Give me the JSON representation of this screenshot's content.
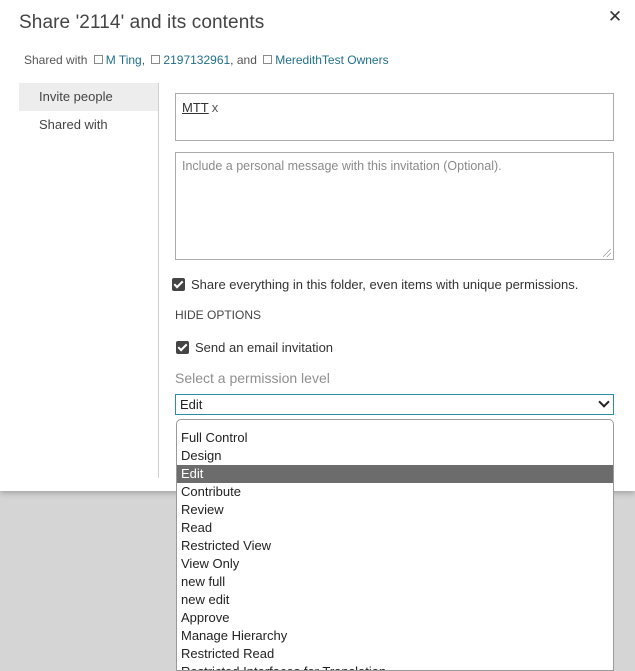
{
  "dialog": {
    "title": "Share '2114' and its contents",
    "close_label": "✕"
  },
  "shared_with": {
    "prefix": "Shared with",
    "users": [
      {
        "name": "M Ting",
        "sep": ","
      },
      {
        "name": "2197132961",
        "sep": ", and"
      },
      {
        "name": "MeredithTest Owners",
        "sep": ""
      }
    ]
  },
  "sidebar": {
    "items": [
      {
        "label": "Invite people",
        "active": true
      },
      {
        "label": "Shared with",
        "active": false
      }
    ]
  },
  "invite": {
    "people_entity": "MTT",
    "people_remove": "x",
    "message_placeholder": "Include a personal message with this invitation (Optional)."
  },
  "options": {
    "share_everything_label": "Share everything in this folder, even items with unique permissions.",
    "share_everything_checked": true,
    "hide_options_label": "HIDE OPTIONS",
    "send_email_label": "Send an email invitation",
    "send_email_checked": true,
    "permission_label": "Select a permission level",
    "permission_value": "Edit"
  },
  "permission_options": [
    "Full Control",
    "Design",
    "Edit",
    "Contribute",
    "Review",
    "Read",
    "Restricted View",
    "View Only",
    "new full",
    "new edit",
    "Approve",
    "Manage Hierarchy",
    "Restricted Read",
    "Restricted Interfaces for Translation"
  ],
  "selected_option": "Edit",
  "colors": {
    "accent": "#2a8ea6",
    "link": "#1f6f8b",
    "selected_bg": "#6c6c6c",
    "overlay": "#d5d5d5"
  }
}
